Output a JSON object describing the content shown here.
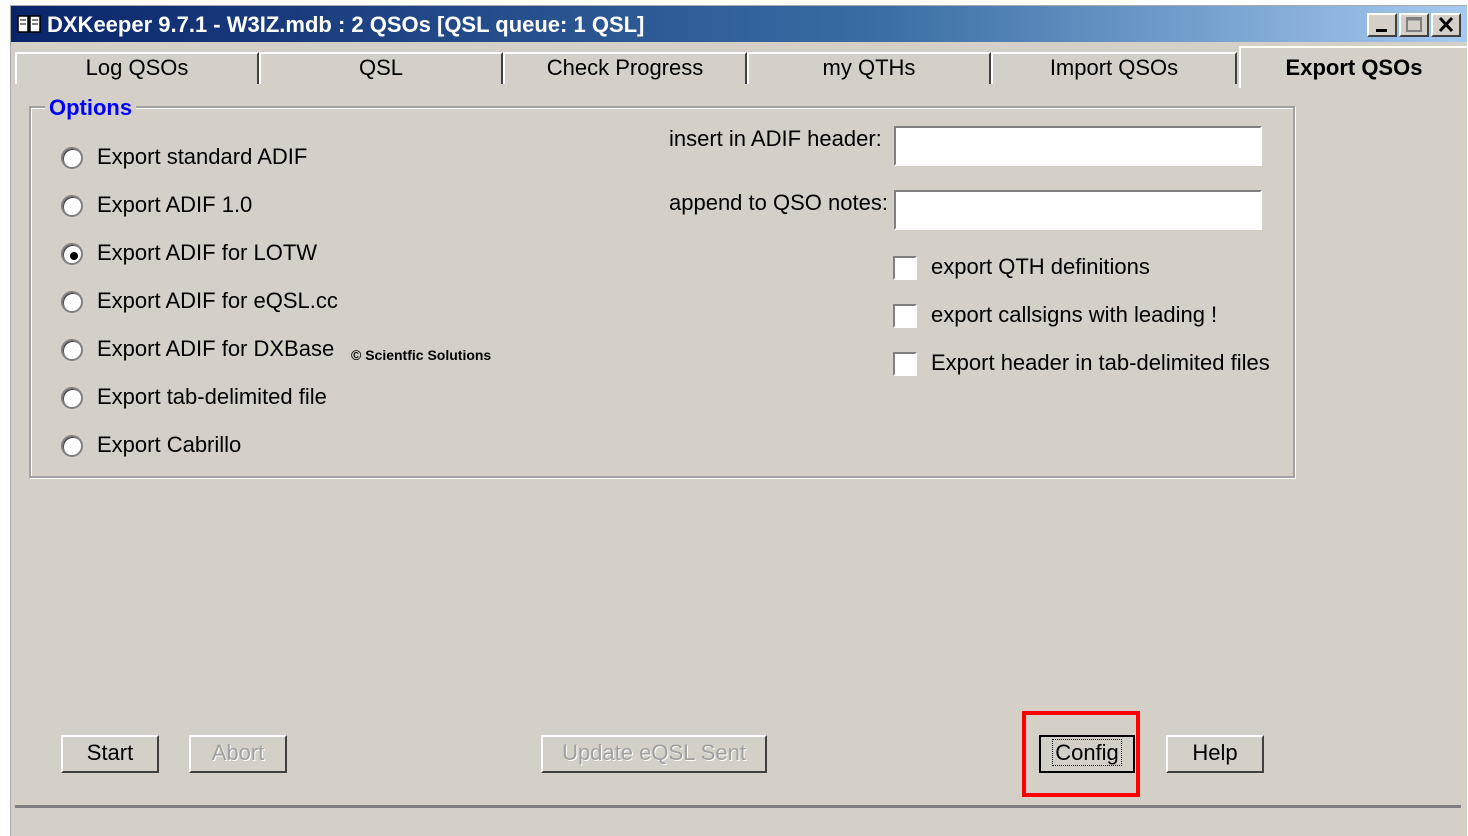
{
  "window": {
    "title": "DXKeeper 9.7.1 - W3IZ.mdb : 2 QSOs [QSL queue: 1 QSL]"
  },
  "tabs": [
    {
      "label": "Log QSOs",
      "active": false
    },
    {
      "label": "QSL",
      "active": false
    },
    {
      "label": "Check Progress",
      "active": false
    },
    {
      "label": "my QTHs",
      "active": false
    },
    {
      "label": "Import QSOs",
      "active": false
    },
    {
      "label": "Export QSOs",
      "active": true
    }
  ],
  "options": {
    "group_label": "Options",
    "radios": [
      {
        "label": "Export standard ADIF",
        "checked": false
      },
      {
        "label": "Export ADIF 1.0",
        "checked": false
      },
      {
        "label": "Export ADIF for LOTW",
        "checked": true
      },
      {
        "label": "Export ADIF for eQSL.cc",
        "checked": false
      },
      {
        "label": "Export ADIF for DXBase",
        "checked": false
      },
      {
        "label": "Export tab-delimited file",
        "checked": false
      },
      {
        "label": "Export Cabrillo",
        "checked": false
      }
    ],
    "dxbase_note": "© Scientfic Solutions",
    "header_label": "insert in ADIF header:",
    "header_value": "",
    "notes_label": "append to QSO notes:",
    "notes_value": "",
    "checkboxes": [
      {
        "label": "export QTH definitions",
        "checked": false
      },
      {
        "label": "export callsigns with leading !",
        "checked": false
      },
      {
        "label": "Export header in tab-delimited files",
        "checked": false
      }
    ]
  },
  "buttons": {
    "start": "Start",
    "abort": "Abort",
    "update_eqsl": "Update eQSL Sent",
    "config": "Config",
    "help": "Help"
  },
  "colors": {
    "highlight": "#ff0000",
    "group_label": "#0000ff",
    "titlebar_start": "#0a246a"
  }
}
